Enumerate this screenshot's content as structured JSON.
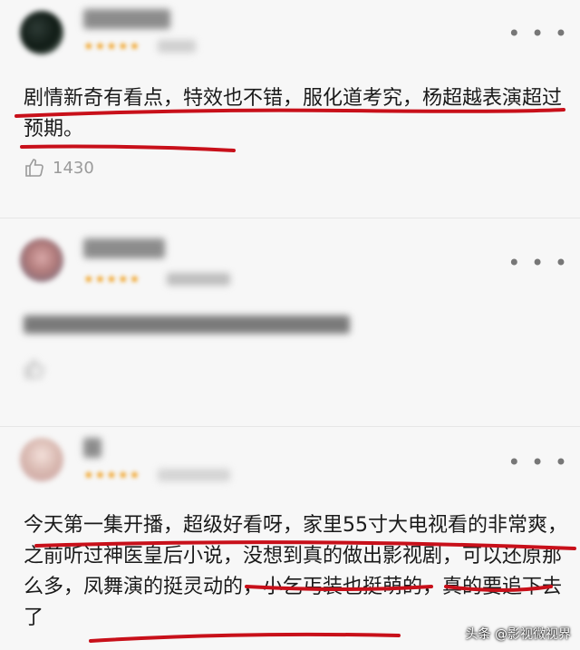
{
  "comments": [
    {
      "text": "剧情新奇有看点，特效也不错，服化道考究，杨超越表演超过预期。",
      "likes": "1430"
    },
    {
      "text": "",
      "likes": "",
      "blurred": true
    },
    {
      "text": "今天第一集开播，超级好看呀，家里55寸大电视看的非常爽，之前听过神医皇后小说，没想到真的做出影视剧，可以还原那么多，凤舞演的挺灵动的，小乞丐装也挺萌的，真的要追下去了"
    }
  ],
  "more_icon": "⋮ more-dots-icon",
  "like_icon": "thumbs-up-icon",
  "watermark": "头条 @影视微视界",
  "colors": {
    "underline": "#c8101a",
    "stars": "#f0a020",
    "background": "#f7f7f7"
  }
}
